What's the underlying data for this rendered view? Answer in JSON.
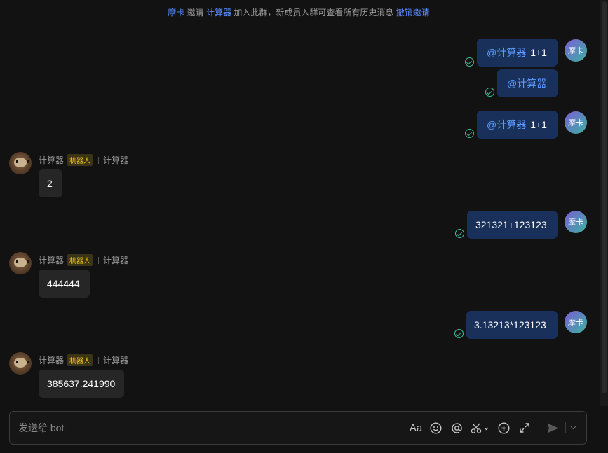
{
  "system_notice": {
    "inviter": "摩卡",
    "verb": "邀请",
    "invitee": "计算器",
    "text": "加入此群，新成员入群可查看所有历史消息",
    "revoke": "撤销邀请"
  },
  "user": {
    "avatar_text": "摩卡"
  },
  "bot": {
    "name": "计算器",
    "badge": "机器人",
    "alias": "计算器"
  },
  "messages": {
    "m1": {
      "mention": "@计算器",
      "text": "1+1"
    },
    "m2": {
      "mention": "@计算器"
    },
    "m3": {
      "mention": "@计算器",
      "text": "1+1"
    },
    "r1": {
      "text": "2"
    },
    "m4": {
      "text": "321321+123123"
    },
    "r2": {
      "text": "444444"
    },
    "m5": {
      "text": "3.13213*123123"
    },
    "r3": {
      "text": "385637.241990"
    }
  },
  "composer": {
    "placeholder": "发送给 bot",
    "format_label": "Aa"
  },
  "colors": {
    "background": "#121212",
    "outgoing_bubble": "#19305a",
    "incoming_bubble": "#262626",
    "mention": "#5b9dff",
    "badge": "#f5c518",
    "read_check": "#3fbf9f"
  }
}
